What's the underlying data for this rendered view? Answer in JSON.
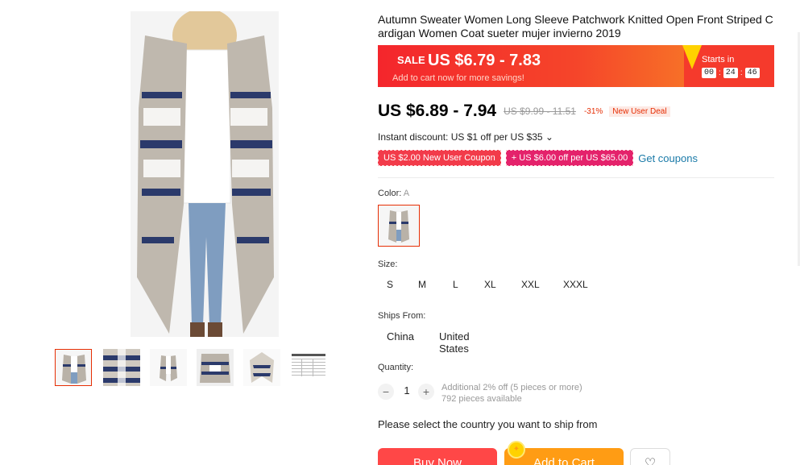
{
  "product": {
    "title": "Autumn Sweater Women Long Sleeve Patchwork Knitted Open Front Striped Cardigan Women Coat sueter mujer invierno 2019",
    "main_image_icon": "cardigan-model-photo",
    "thumbnails": [
      {
        "icon": "cardigan-front-thumb"
      },
      {
        "icon": "cardigan-detail-thumb"
      },
      {
        "icon": "cardigan-model-thumb"
      },
      {
        "icon": "cardigan-back-thumb"
      },
      {
        "icon": "cardigan-flat-thumb"
      },
      {
        "icon": "size-chart-thumb"
      }
    ]
  },
  "sale": {
    "sale_word": "SALE",
    "sale_price": "US $6.79 - 7.83",
    "sub_text": "Add to cart now for more savings!",
    "starts_in_label": "Starts in",
    "timer": {
      "h": "00",
      "m": "24",
      "s": "46"
    }
  },
  "pricing": {
    "current": "US $6.89 - 7.94",
    "original": "US $9.99 - 11.51",
    "discount": "-31%",
    "deal_badge": "New User Deal"
  },
  "instant_discount": "Instant discount: US $1 off per US $35 ⌄",
  "coupons": {
    "coupon1": "US $2.00 New User Coupon",
    "coupon2": "+ US $6.00 off per US $65.00",
    "link": "Get coupons"
  },
  "color": {
    "label": "Color:",
    "selected": "A"
  },
  "size": {
    "label": "Size:",
    "options": [
      "S",
      "M",
      "L",
      "XL",
      "XXL",
      "XXXL"
    ]
  },
  "ships_from": {
    "label": "Ships From:",
    "options": [
      "China",
      "United States"
    ]
  },
  "quantity": {
    "label": "Quantity:",
    "value": "1",
    "minus": "−",
    "plus": "+",
    "note_line1": "Additional 2% off (5 pieces or more)",
    "note_line2": "792 pieces available"
  },
  "ship_message": "Please select the country you want to ship from",
  "actions": {
    "buy_now": "Buy Now",
    "add_to_cart": "Add to Cart",
    "wishlist_icon": "♡"
  },
  "colors": {
    "accent_red": "#e62e04",
    "sale_gradient_start": "#f4262c",
    "sale_gradient_end": "#f99325",
    "buy_button": "#ff4747",
    "cart_button": "#ff9c14",
    "link": "#1a7aa8"
  }
}
